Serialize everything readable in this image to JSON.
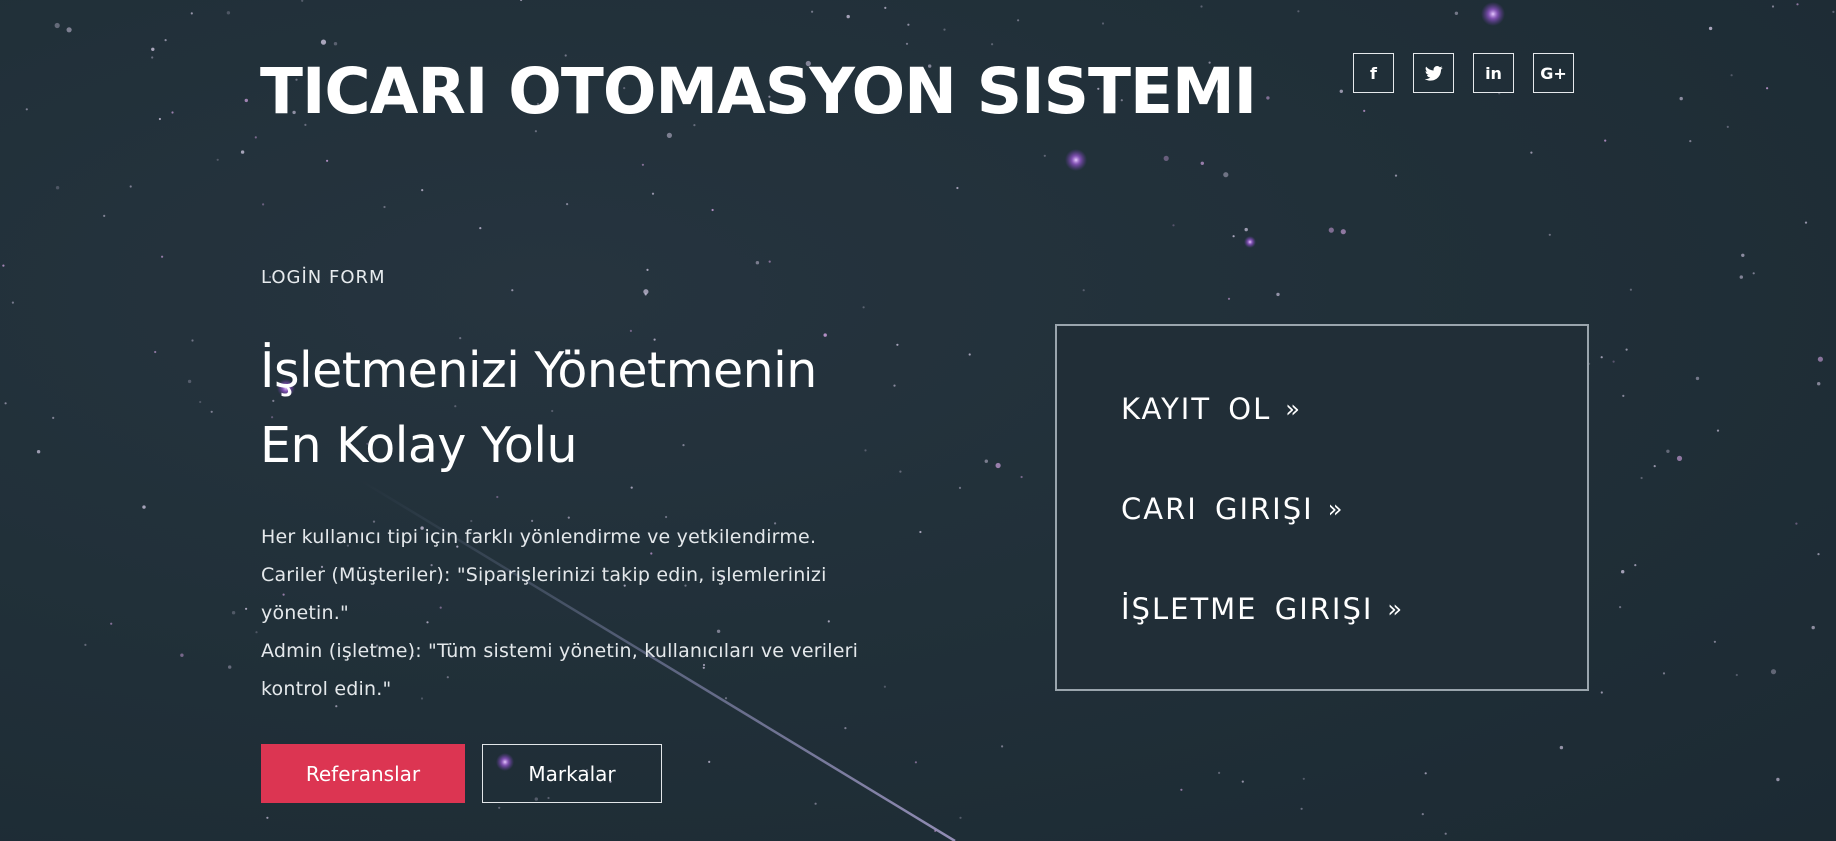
{
  "header": {
    "title": "TICARI OTOMASYON SISTEMI",
    "social": [
      {
        "icon": "facebook-icon",
        "glyph": "f"
      },
      {
        "icon": "twitter-icon",
        "glyph": ""
      },
      {
        "icon": "linkedin-icon",
        "glyph": "in"
      },
      {
        "icon": "google-plus-icon",
        "glyph": "G+"
      }
    ]
  },
  "hero": {
    "eyebrow": "LOGİN FORM",
    "headline_line1": "İşletmenizi Yönetmenin",
    "headline_line2": "En Kolay Yolu",
    "description": [
      "Her kullanıcı tipi için farklı yönlendirme ve yetkilendirme.",
      "Cariler (Müşteriler): \"Siparişlerinizi takip edin, işlemlerinizi yönetin.\"",
      "Admin (işletme): \"Tüm sistemi yönetin, kullanıcıları ve verileri kontrol edin.\""
    ],
    "buttons": {
      "primary_label": "Referanslar",
      "secondary_label": "Markalar"
    }
  },
  "login_box": {
    "links": [
      {
        "label": "KAYIT OL",
        "arrow": "»"
      },
      {
        "label": "CARI GIRIŞI",
        "arrow": "»"
      },
      {
        "label": "İŞLETME GIRIŞI",
        "arrow": "»"
      }
    ]
  },
  "colors": {
    "background": "#22313a",
    "primary_button": "#dc3552",
    "text": "#ffffff"
  }
}
